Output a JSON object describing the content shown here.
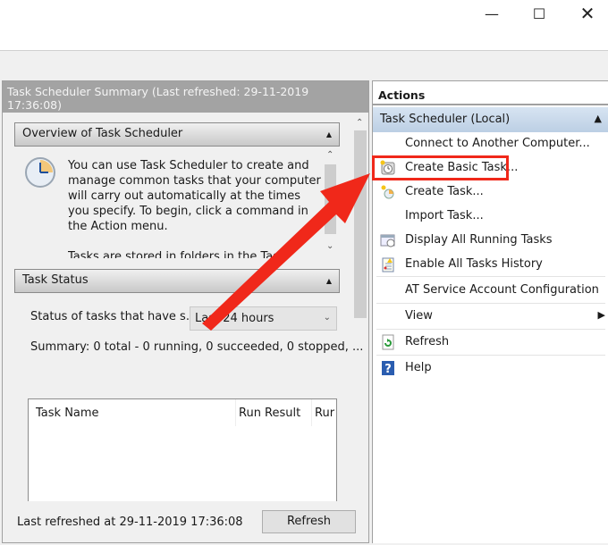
{
  "window": {
    "controls": [
      "minimize",
      "maximize",
      "close"
    ]
  },
  "summary": {
    "title": "Task Scheduler Summary (Last refreshed: 29-11-2019 17:36:08)",
    "overview": {
      "header": "Overview of Task Scheduler",
      "text": "You can use Task Scheduler to create and manage common tasks that your computer will carry out automatically at the times you specify. To begin, click a command in the Action menu.",
      "text2": "Tasks are stored in folders in the Task"
    },
    "status": {
      "header": "Task Status",
      "label": "Status of tasks that have s...",
      "dropdown_value": "Last 24 hours",
      "summary": "Summary: 0 total - 0 running, 0 succeeded, 0 stopped, ...",
      "columns": [
        "Task Name",
        "Run Result",
        "Rur"
      ]
    },
    "footer": {
      "last_refreshed": "Last refreshed at 29-11-2019 17:36:08",
      "refresh_label": "Refresh"
    }
  },
  "actions": {
    "header": "Actions",
    "group": "Task Scheduler (Local)",
    "items": [
      {
        "label": "Connect to Another Computer...",
        "icon": ""
      },
      {
        "label": "Create Basic Task...",
        "icon": "create-basic-task-icon",
        "highlighted": true
      },
      {
        "label": "Create Task...",
        "icon": "create-task-icon"
      },
      {
        "label": "Import Task...",
        "icon": ""
      },
      {
        "label": "Display All Running Tasks",
        "icon": "running-tasks-icon"
      },
      {
        "label": "Enable All Tasks History",
        "icon": "history-icon"
      },
      {
        "label": "AT Service Account Configuration",
        "icon": ""
      },
      {
        "label": "View",
        "icon": "",
        "submenu": true
      },
      {
        "label": "Refresh",
        "icon": "refresh-icon"
      },
      {
        "label": "Help",
        "icon": "help-icon"
      }
    ]
  },
  "annotation": {
    "color": "#f0281a"
  }
}
